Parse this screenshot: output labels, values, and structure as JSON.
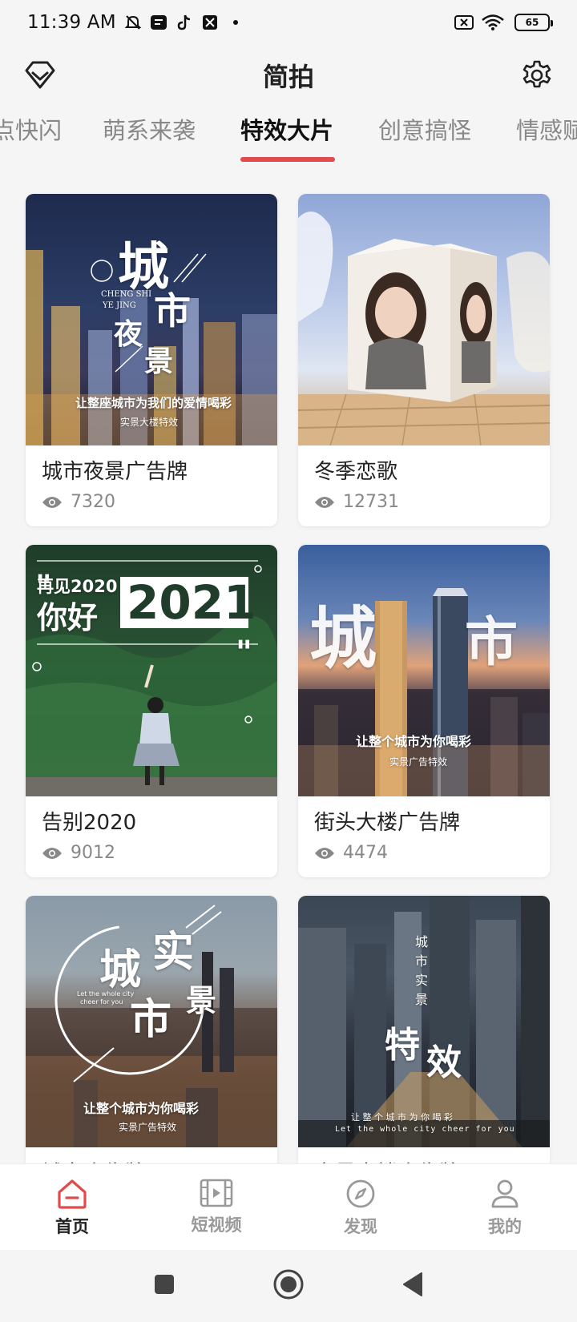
{
  "status_bar": {
    "time": "11:39 AM",
    "battery": "65"
  },
  "header": {
    "title": "简拍"
  },
  "tabs": [
    {
      "label": "点快闪"
    },
    {
      "label": "萌系来袭"
    },
    {
      "label": "特效大片"
    },
    {
      "label": "创意搞怪"
    },
    {
      "label": "情感赋"
    }
  ],
  "cards": [
    {
      "title": "城市夜景广告牌",
      "views": "7320",
      "art": {
        "big1": "城",
        "big2": "市",
        "big3": "夜",
        "big4": "景",
        "pinyin1": "CHENG SHI",
        "pinyin2": "YE JING",
        "line1": "让整座城市为我们的爱情喝彩",
        "line2": "实景大楼特效"
      }
    },
    {
      "title": "冬季恋歌",
      "views": "12731"
    },
    {
      "title": "告别2020",
      "views": "9012",
      "art": {
        "bye": "再见2020",
        "hello": "你好",
        "year": "2021"
      }
    },
    {
      "title": "街头大楼广告牌",
      "views": "4474",
      "art": {
        "left": "城",
        "right": "市",
        "line1": "让整个城市为你喝彩",
        "line2": "实景广告特效"
      }
    },
    {
      "title": "城市广告牌",
      "views": "",
      "art": {
        "c1": "城",
        "c2": "实",
        "c3": "市",
        "c4": "景",
        "en1": "Let the whole city",
        "en2": "cheer for you",
        "line1": "让整个城市为你喝彩",
        "line2": "实景广告特效"
      }
    },
    {
      "title": "实景大楼广告牌",
      "views": "",
      "art": {
        "v1": "城",
        "v2": "市",
        "v3": "实",
        "v4": "景",
        "big1": "特",
        "big2": "效",
        "line1": "让 整 个 城 市 为 你 喝 彩",
        "line2": "Let the whole city cheer for you"
      }
    }
  ],
  "bottom_nav": [
    {
      "label": "首页",
      "icon": "home-icon"
    },
    {
      "label": "短视频",
      "icon": "video-icon"
    },
    {
      "label": "发现",
      "icon": "compass-icon"
    },
    {
      "label": "我的",
      "icon": "profile-icon"
    }
  ],
  "colors": {
    "accent": "#e04b4b",
    "text": "#222222",
    "muted": "#888888"
  }
}
